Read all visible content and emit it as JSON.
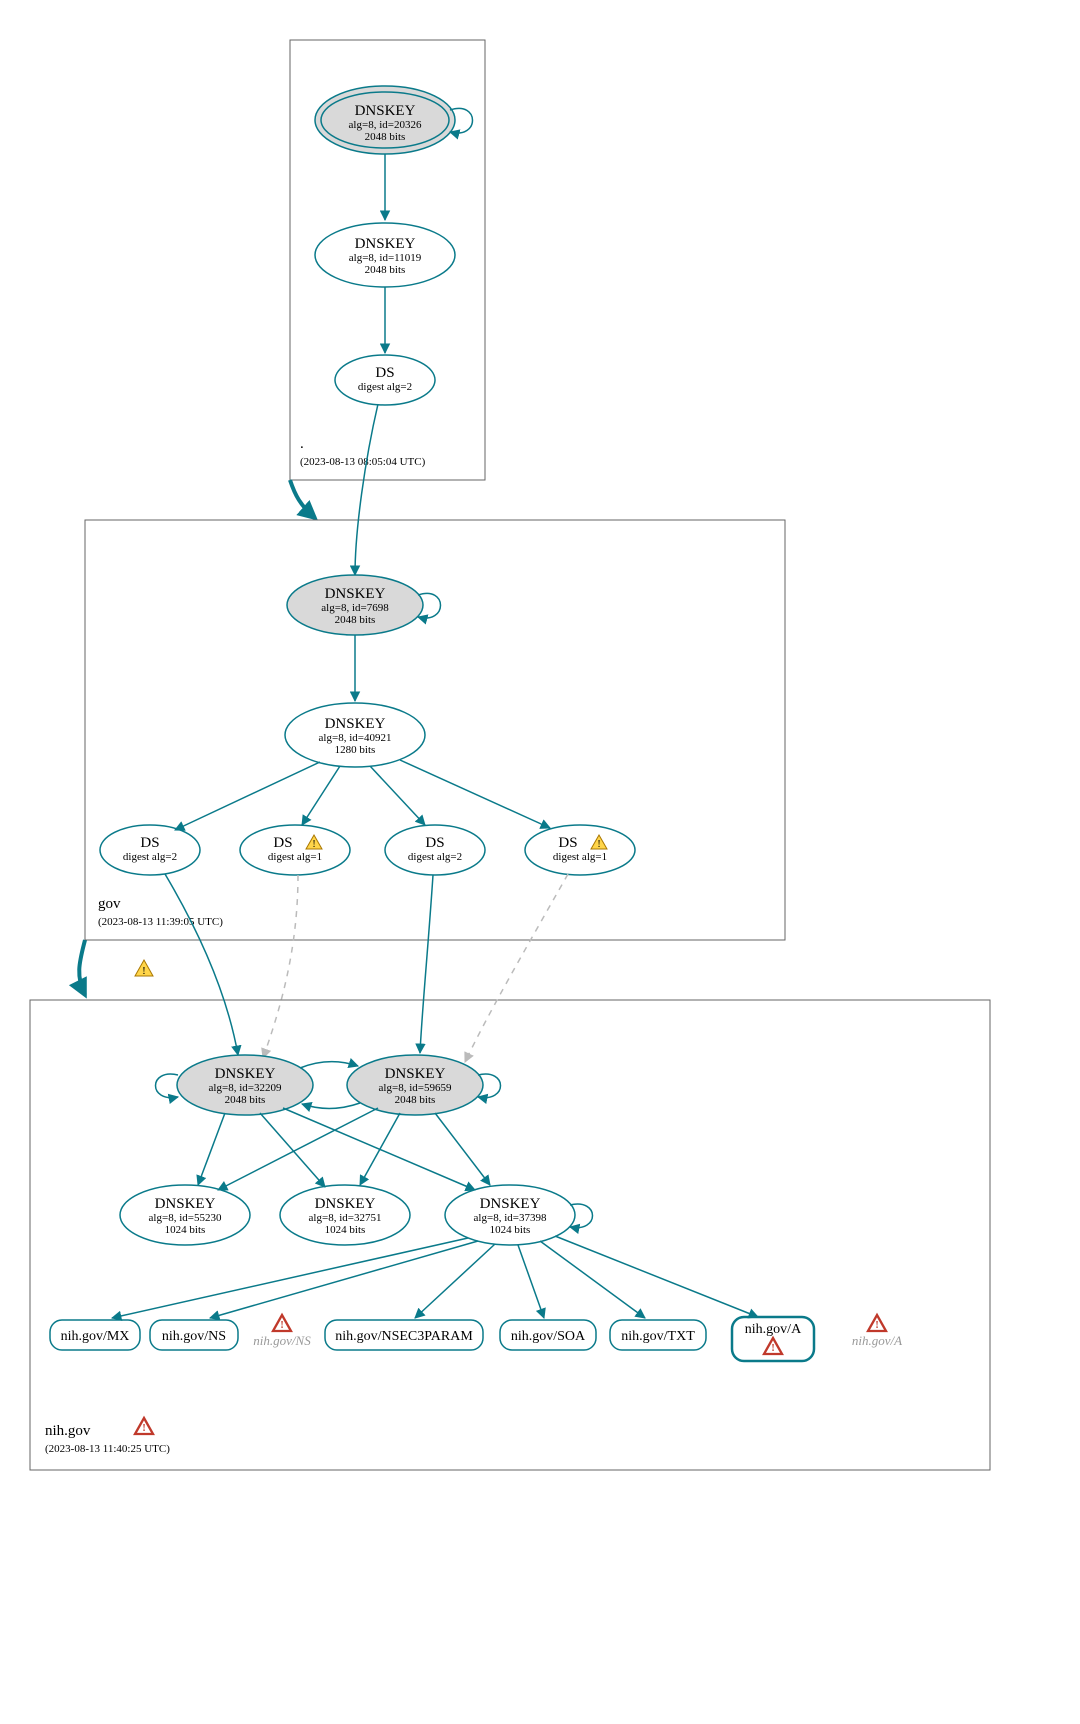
{
  "zones": {
    "root": {
      "label": ".",
      "timestamp": "(2023-08-13 08:05:04 UTC)"
    },
    "gov": {
      "label": "gov",
      "timestamp": "(2023-08-13 11:39:05 UTC)"
    },
    "nih": {
      "label": "nih.gov",
      "timestamp": "(2023-08-13 11:40:25 UTC)"
    }
  },
  "nodes": {
    "root_ksk": {
      "title": "DNSKEY",
      "sub1": "alg=8, id=20326",
      "sub2": "2048 bits"
    },
    "root_zsk": {
      "title": "DNSKEY",
      "sub1": "alg=8, id=11019",
      "sub2": "2048 bits"
    },
    "root_ds": {
      "title": "DS",
      "sub1": "digest alg=2"
    },
    "gov_ksk": {
      "title": "DNSKEY",
      "sub1": "alg=8, id=7698",
      "sub2": "2048 bits"
    },
    "gov_zsk": {
      "title": "DNSKEY",
      "sub1": "alg=8, id=40921",
      "sub2": "1280 bits"
    },
    "gov_ds1": {
      "title": "DS",
      "sub1": "digest alg=2"
    },
    "gov_ds2": {
      "title": "DS",
      "sub1": "digest alg=1"
    },
    "gov_ds3": {
      "title": "DS",
      "sub1": "digest alg=2"
    },
    "gov_ds4": {
      "title": "DS",
      "sub1": "digest alg=1"
    },
    "nih_ksk1": {
      "title": "DNSKEY",
      "sub1": "alg=8, id=32209",
      "sub2": "2048 bits"
    },
    "nih_ksk2": {
      "title": "DNSKEY",
      "sub1": "alg=8, id=59659",
      "sub2": "2048 bits"
    },
    "nih_zsk1": {
      "title": "DNSKEY",
      "sub1": "alg=8, id=55230",
      "sub2": "1024 bits"
    },
    "nih_zsk2": {
      "title": "DNSKEY",
      "sub1": "alg=8, id=32751",
      "sub2": "1024 bits"
    },
    "nih_zsk3": {
      "title": "DNSKEY",
      "sub1": "alg=8, id=37398",
      "sub2": "1024 bits"
    }
  },
  "rrsets": {
    "mx": {
      "label": "nih.gov/MX"
    },
    "ns": {
      "label": "nih.gov/NS"
    },
    "nsec3": {
      "label": "nih.gov/NSEC3PARAM"
    },
    "soa": {
      "label": "nih.gov/SOA"
    },
    "txt": {
      "label": "nih.gov/TXT"
    },
    "a": {
      "label": "nih.gov/A"
    }
  },
  "ghosts": {
    "ns": {
      "label": "nih.gov/NS"
    },
    "a": {
      "label": "nih.gov/A"
    }
  }
}
